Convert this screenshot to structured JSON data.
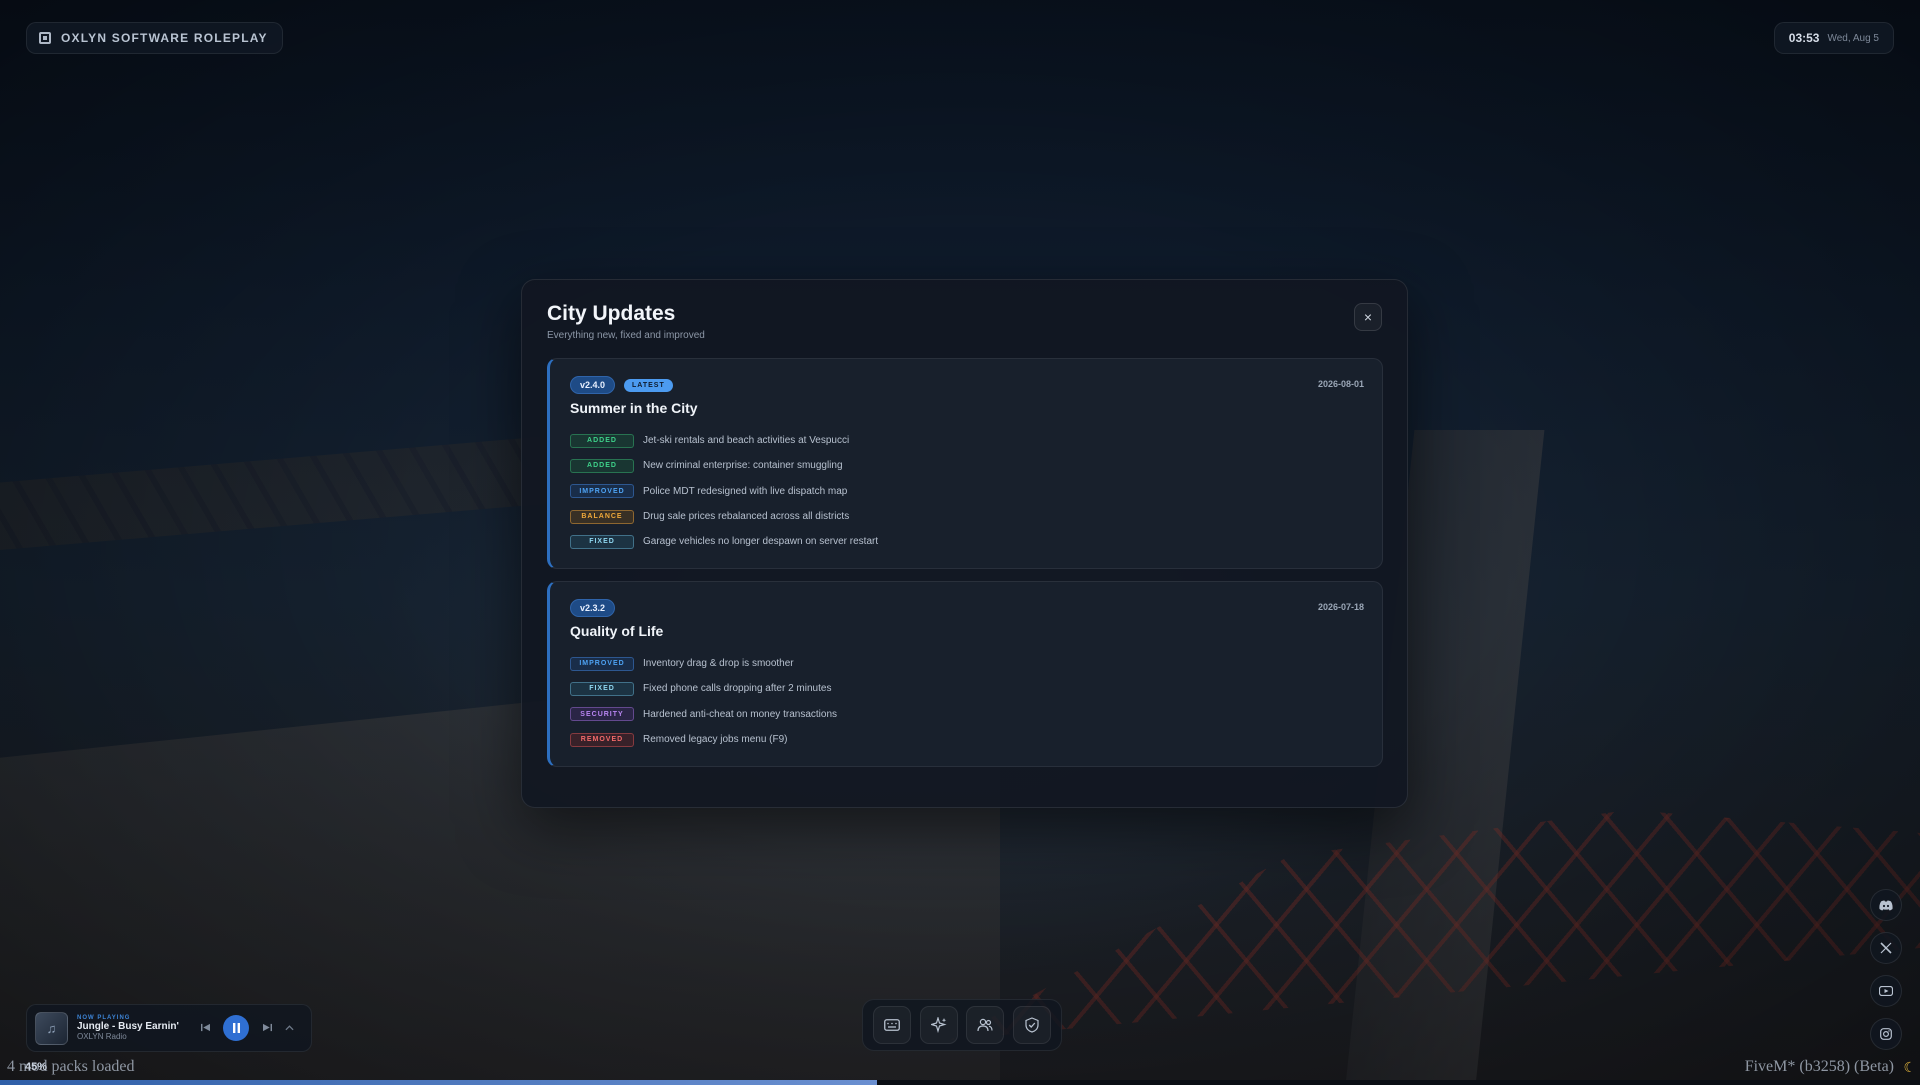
{
  "brand": {
    "name": "OXLYN SOFTWARE ROLEPLAY",
    "icon": "server-icon"
  },
  "clock": {
    "time": "03:53",
    "date": "Wed, Aug 5"
  },
  "modal": {
    "title": "City Updates",
    "subtitle": "Everything new, fixed and improved",
    "close_icon": "×"
  },
  "releases": [
    {
      "version": "v2.4.0",
      "latest_label": "LATEST",
      "date": "2026-08-01",
      "name": "Summer in the City",
      "changes": [
        {
          "tag": "ADDED",
          "text": "Jet-ski rentals and beach activities at Vespucci"
        },
        {
          "tag": "ADDED",
          "text": "New criminal enterprise: container smuggling"
        },
        {
          "tag": "IMPROVED",
          "text": "Police MDT redesigned with live dispatch map"
        },
        {
          "tag": "BALANCE",
          "text": "Drug sale prices rebalanced across all districts"
        },
        {
          "tag": "FIXED",
          "text": "Garage vehicles no longer despawn on server restart"
        }
      ]
    },
    {
      "version": "v2.3.2",
      "date": "2026-07-18",
      "name": "Quality of Life",
      "changes": [
        {
          "tag": "IMPROVED",
          "text": "Inventory drag & drop is smoother"
        },
        {
          "tag": "FIXED",
          "text": "Fixed phone calls dropping after 2 minutes"
        },
        {
          "tag": "SECURITY",
          "text": "Hardened anti-cheat on money transactions"
        },
        {
          "tag": "REMOVED",
          "text": "Removed legacy jobs menu (F9)"
        }
      ]
    }
  ],
  "tag_colors": {
    "ADDED": "#3ed28a",
    "IMPROVED": "#4ea3f4",
    "BALANCE": "#f0a93a",
    "FIXED": "#8fd7f0",
    "SECURITY": "#b885f2",
    "REMOVED": "#f26a6a"
  },
  "player": {
    "now_playing_label": "NOW PLAYING",
    "title": "Jungle - Busy Earnin'",
    "artist": "OXLYN Radio",
    "state": "playing"
  },
  "dock": [
    {
      "name": "keyboard-icon"
    },
    {
      "name": "sparkles-icon"
    },
    {
      "name": "users-icon"
    },
    {
      "name": "shield-check-icon"
    }
  ],
  "socials": [
    "discord-icon",
    "x-icon",
    "youtube-icon",
    "instagram-icon"
  ],
  "loading": {
    "left_text": "4 mod packs loaded",
    "percent": "45%",
    "right_text": "FiveM* (b3258) (Beta)",
    "progress": 0.457
  },
  "accent": "#2f6fd2"
}
